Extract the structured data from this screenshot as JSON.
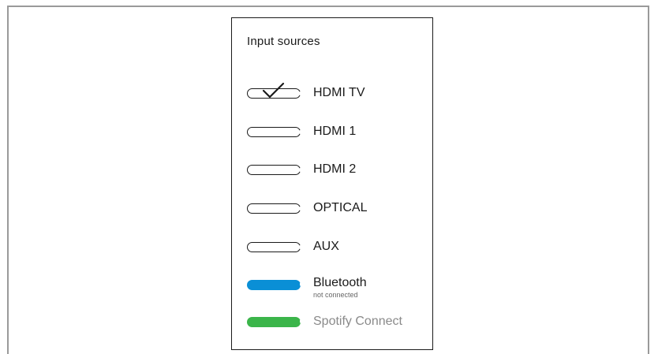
{
  "panel": {
    "title": "Input sources"
  },
  "sources": [
    {
      "label": "HDMI TV",
      "selected": true,
      "icon": "check-icon"
    },
    {
      "label": "HDMI 1",
      "selected": false
    },
    {
      "label": "HDMI 2",
      "selected": false
    },
    {
      "label": "OPTICAL",
      "selected": false
    },
    {
      "label": "AUX",
      "selected": false
    },
    {
      "label": "Bluetooth",
      "status": "not connected",
      "color": "#0a8fd6"
    },
    {
      "label": "Spotify Connect",
      "color": "#3bb54a",
      "text_color": "#8a8a8a"
    }
  ],
  "colors": {
    "frame_border": "#9a9a9a",
    "text": "#1a1a1a",
    "bluetooth": "#0a8fd6",
    "spotify": "#3bb54a",
    "muted_text": "#8a8a8a"
  }
}
